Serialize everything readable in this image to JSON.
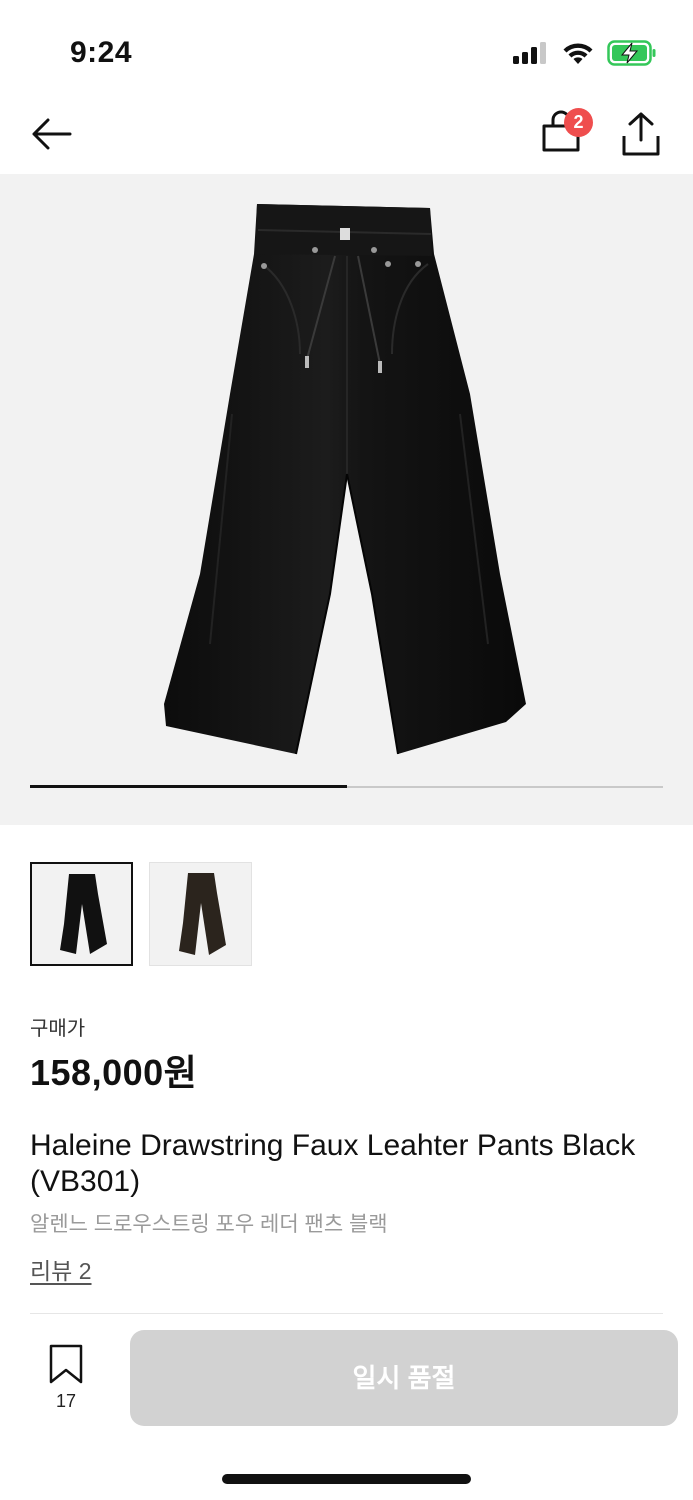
{
  "status_bar": {
    "time": "9:24"
  },
  "nav": {
    "cart_count": "2"
  },
  "gallery": {
    "progress": 0.5,
    "image_count": 2,
    "selected_index": 0
  },
  "product": {
    "price_label": "구매가",
    "price": "158,000원",
    "title": "Haleine Drawstring Faux Leahter Pants Black (VB301)",
    "subtitle": "알렌느 드로우스트링 포우 레더 팬츠 블랙",
    "reviews": "리뷰 2"
  },
  "bottom_bar": {
    "bookmark_count": "17",
    "action_label": "일시 품절"
  },
  "colors": {
    "badge": "#ef4e4e",
    "disabled_button": "#d2d2d2",
    "battery": "#34c759"
  }
}
